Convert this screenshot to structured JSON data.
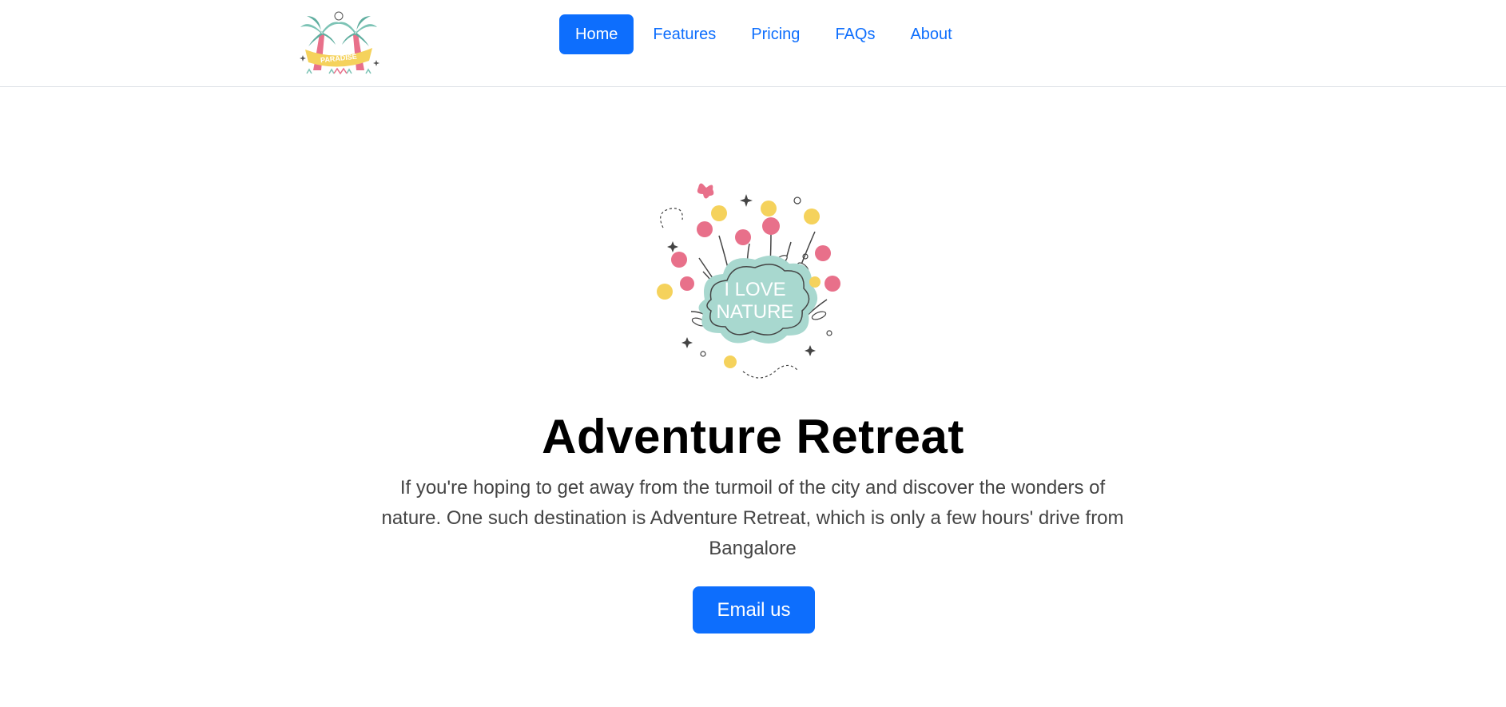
{
  "header": {
    "logo": {
      "icon": "palm-trees-paradise-logo",
      "text": "PARADISE"
    },
    "nav": [
      {
        "label": "Home",
        "active": true
      },
      {
        "label": "Features",
        "active": false
      },
      {
        "label": "Pricing",
        "active": false
      },
      {
        "label": "FAQs",
        "active": false
      },
      {
        "label": "About",
        "active": false
      }
    ]
  },
  "hero": {
    "image": {
      "icon": "i-love-nature-floral-illustration",
      "line1": "I LOVE",
      "line2": "NATURE"
    },
    "title": "Adventure Retreat",
    "lead": "If you're hoping to get away from the turmoil of the city and discover the wonders of nature. One such destination is Adventure Retreat, which is only a few hours' drive from Bangalore",
    "button_label": "Email us"
  },
  "colors": {
    "primary": "#0d6efd",
    "border": "#dee2e6",
    "teal": "#a8d8cf",
    "pink": "#e8708a",
    "yellow": "#f5d25c"
  }
}
